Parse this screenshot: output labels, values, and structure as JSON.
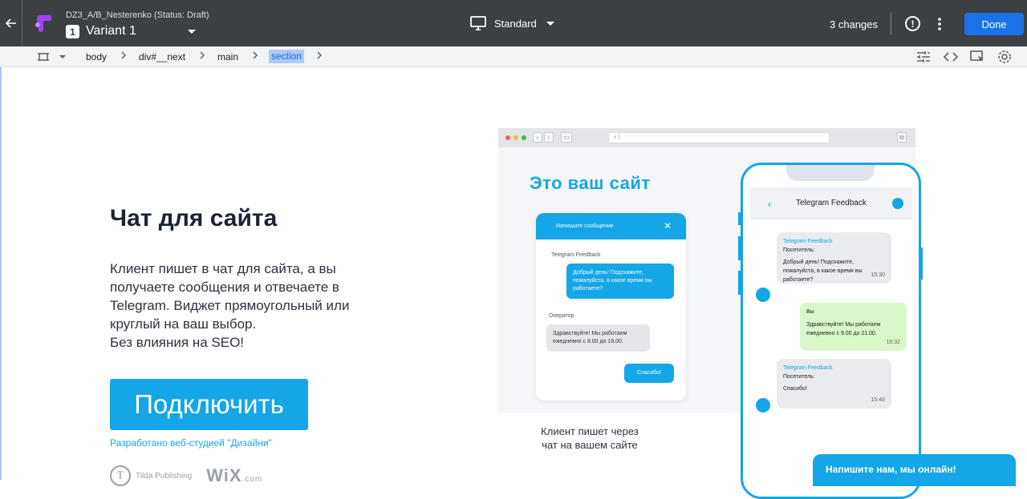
{
  "topbar": {
    "experiment_name": "DZ3_A/B_Nesterenko (Status: Draft)",
    "variant_number": "1",
    "variant_name": "Variant 1",
    "device": "Standard",
    "changes": "3 changes",
    "done_label": "Done"
  },
  "breadcrumb": {
    "items": [
      "body",
      "div#__next",
      "main",
      "section"
    ],
    "active_index": 3
  },
  "page": {
    "title": "Чат для сайта",
    "description_lines": [
      "Клиент пишет в чат для сайта, а вы",
      "получаете сообщения и отвечаете в",
      "Telegram. Виджет прямоугольный или",
      "круглый на ваш выбор.",
      "Без влияния на SEO!"
    ],
    "connect_button": "Подключить",
    "credit": "Разработано веб-студией \"Дизайни\"",
    "tilda_label": "Tilda Publishing",
    "wix_label": "WiX",
    "wix_suffix": ".com"
  },
  "illustration": {
    "title": "Это ваш сайт",
    "widget_header": "Напишите сообщение",
    "widget_sender1": "Telegram Feedback",
    "widget_msg1": "Добрый день! Подскажите, пожалуйста, в какое время вы работаете?",
    "widget_sender2": "Оператор",
    "widget_msg2": "Здравствуйте! Мы работаем ежедневно с 8.00 до 19.00.",
    "widget_msg3": "Спасибо!",
    "caption_lines": [
      "Клиент пишет через",
      "чат на вашем сайте"
    ]
  },
  "phone": {
    "header_name": "Telegram Feedback",
    "msg1_sender": "Telegram Feedback",
    "msg1_label": "Посетитель:",
    "msg1_text": "Добрый день! Подскажите, пожалуйста, в какое время вы работаете?",
    "msg1_time": "15:30",
    "msg2_sender": "Вы",
    "msg2_text": "Здравствуйте! Мы работаем ежедневно с 9.00 до 21.00.",
    "msg2_time": "15:32",
    "msg3_sender": "Telegram Feedback",
    "msg3_label": "Посетитель:",
    "msg3_text": "Спасибо!",
    "msg3_time": "15:40"
  },
  "chat_popup": "Напишите нам, мы онлайн!",
  "colors": {
    "accent": "#14a6e6",
    "toolbar": "#3c4043",
    "done_button": "#1a73e8"
  }
}
